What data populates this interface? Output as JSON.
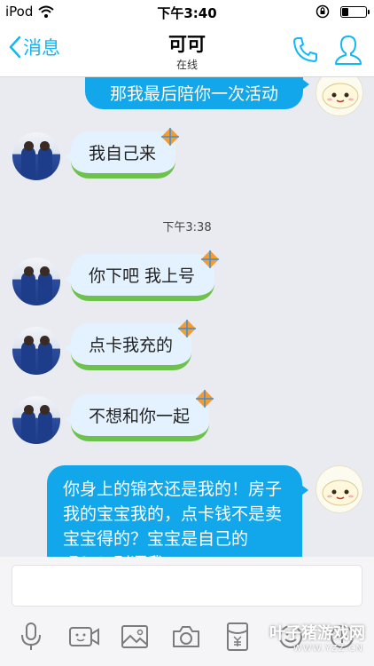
{
  "status_bar": {
    "carrier": "iPod",
    "time": "下午3:40",
    "battery_level": 0.25
  },
  "nav": {
    "back_label": "消息",
    "title": "可可",
    "subtitle": "在线",
    "icons": [
      "phone-icon",
      "profile-icon"
    ]
  },
  "chat": {
    "timestamp": "下午3:38",
    "messages": [
      {
        "side": "out",
        "text": "那我最后陪你一次活动"
      },
      {
        "side": "in",
        "text": "我自己来"
      },
      {
        "side": "in",
        "text": "你下吧 我上号"
      },
      {
        "side": "in",
        "text": "点卡我充的"
      },
      {
        "side": "in",
        "text": "不想和你一起"
      },
      {
        "side": "out",
        "text": "你身上的锦衣还是我的！房子我的宝宝我的，点卡钱不是卖宝宝得的？宝宝是自己的吗？！别逼我"
      }
    ]
  },
  "input": {
    "value": "",
    "toolbar_icons": [
      "microphone-icon",
      "video-icon",
      "image-icon",
      "camera-icon",
      "red-packet-icon",
      "emoji-icon",
      "plus-icon"
    ]
  },
  "watermark": {
    "text": "叶子猪游戏网",
    "url": "WWW.YZZ.CN"
  },
  "colors": {
    "accent": "#12b7f5",
    "outgoing_bubble": "#12a7ea",
    "incoming_bubble": "#e4f2ff",
    "chat_background": "#e9ebf0"
  }
}
